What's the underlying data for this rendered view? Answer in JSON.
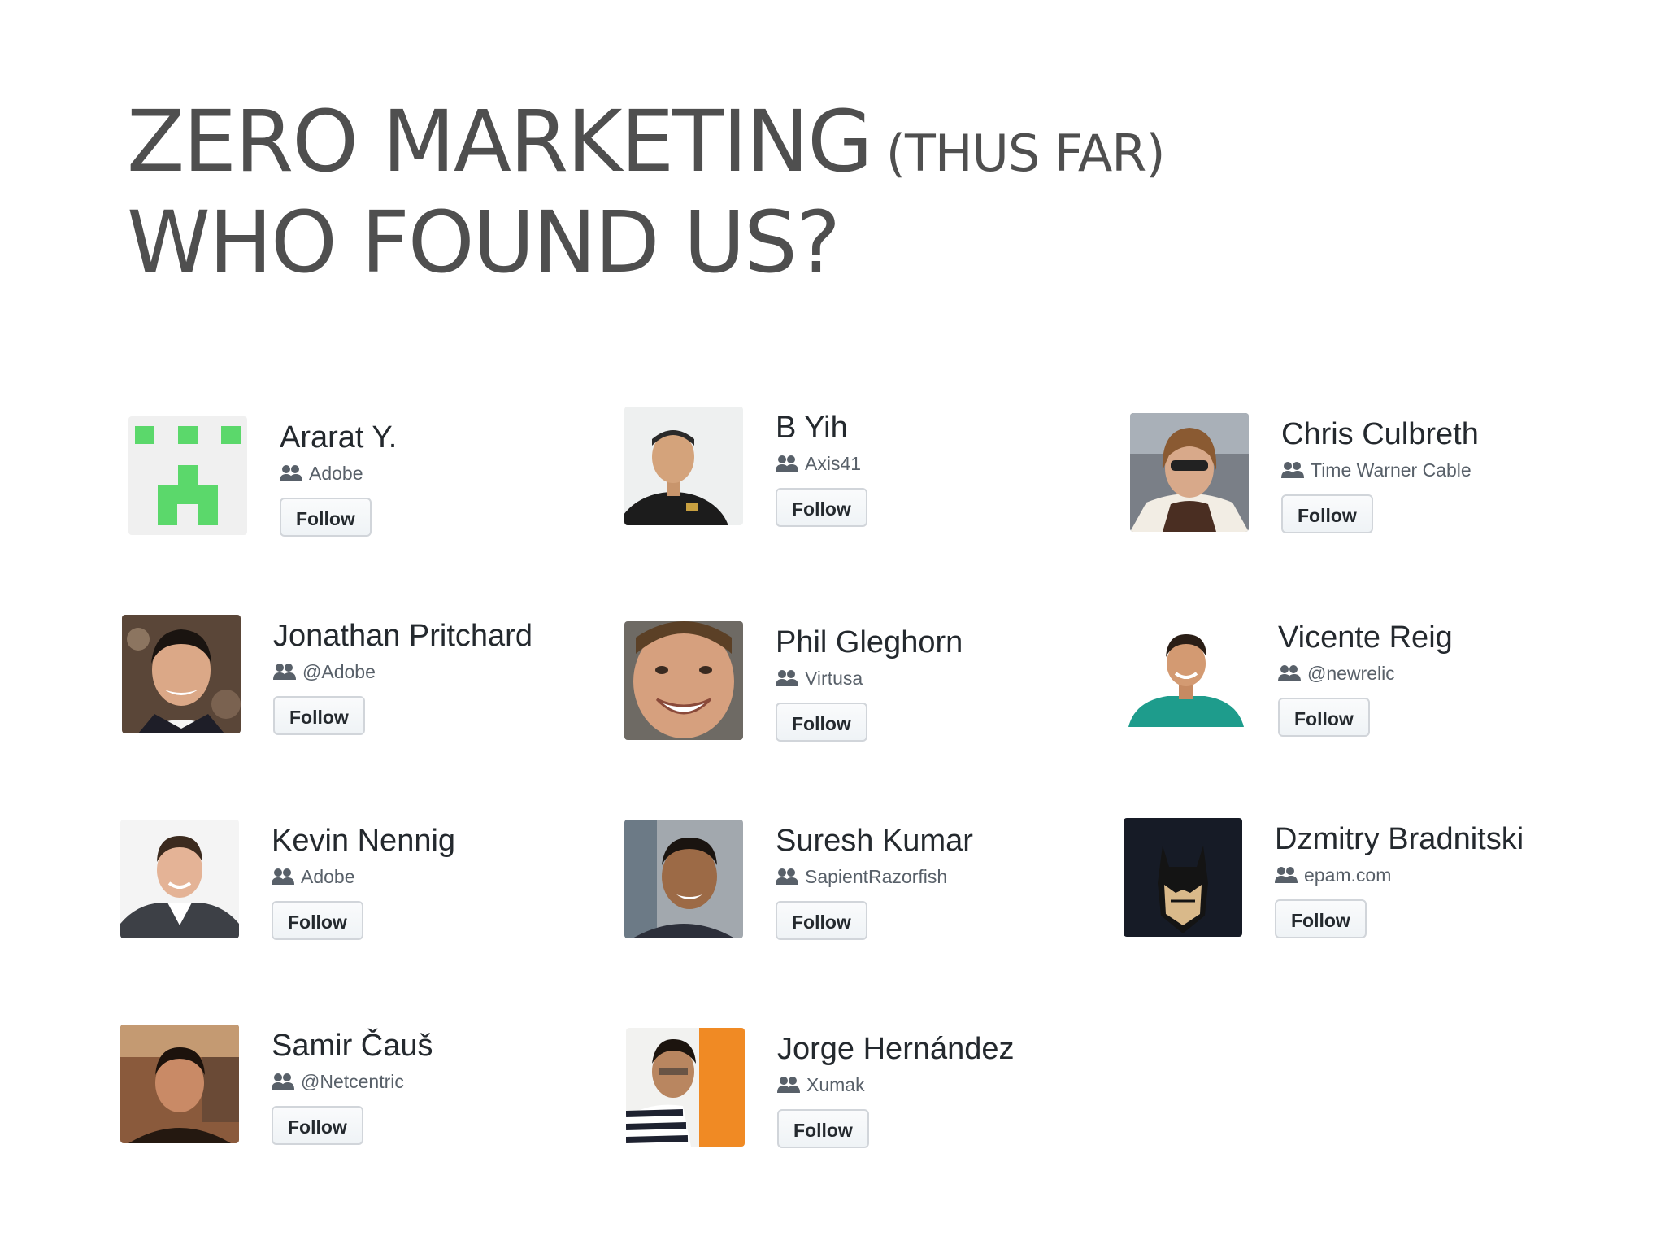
{
  "title": {
    "line1_main": "ZERO MARKETING",
    "line1_paren": "(THUS FAR)",
    "line2": "WHO FOUND US?"
  },
  "org_icon": "people-icon",
  "people": [
    {
      "name": "Ararat Y.",
      "org": "Adobe",
      "follow": "Follow",
      "avatar": "pixel-identicon"
    },
    {
      "name": "B Yih",
      "org": "Axis41",
      "follow": "Follow",
      "avatar": "photo"
    },
    {
      "name": "Chris Culbreth",
      "org": "Time Warner Cable",
      "follow": "Follow",
      "avatar": "photo"
    },
    {
      "name": "Jonathan Pritchard",
      "org": "@Adobe",
      "follow": "Follow",
      "avatar": "photo"
    },
    {
      "name": "Phil Gleghorn",
      "org": "Virtusa",
      "follow": "Follow",
      "avatar": "photo"
    },
    {
      "name": "Vicente Reig",
      "org": "@newrelic",
      "follow": "Follow",
      "avatar": "photo"
    },
    {
      "name": "Kevin Nennig",
      "org": "Adobe",
      "follow": "Follow",
      "avatar": "photo"
    },
    {
      "name": "Suresh Kumar",
      "org": "SapientRazorfish",
      "follow": "Follow",
      "avatar": "photo"
    },
    {
      "name": "Dzmitry Bradnitski",
      "org": "epam.com",
      "follow": "Follow",
      "avatar": "batman-illustration"
    },
    {
      "name": "Samir Čauš",
      "org": "@Netcentric",
      "follow": "Follow",
      "avatar": "photo"
    },
    {
      "name": "Jorge Hernández",
      "org": "Xumak",
      "follow": "Follow",
      "avatar": "photo"
    }
  ],
  "colors": {
    "title": "#4f4f4f",
    "identicon_green": "#5bd86b",
    "follow_border": "#d1d5da"
  }
}
